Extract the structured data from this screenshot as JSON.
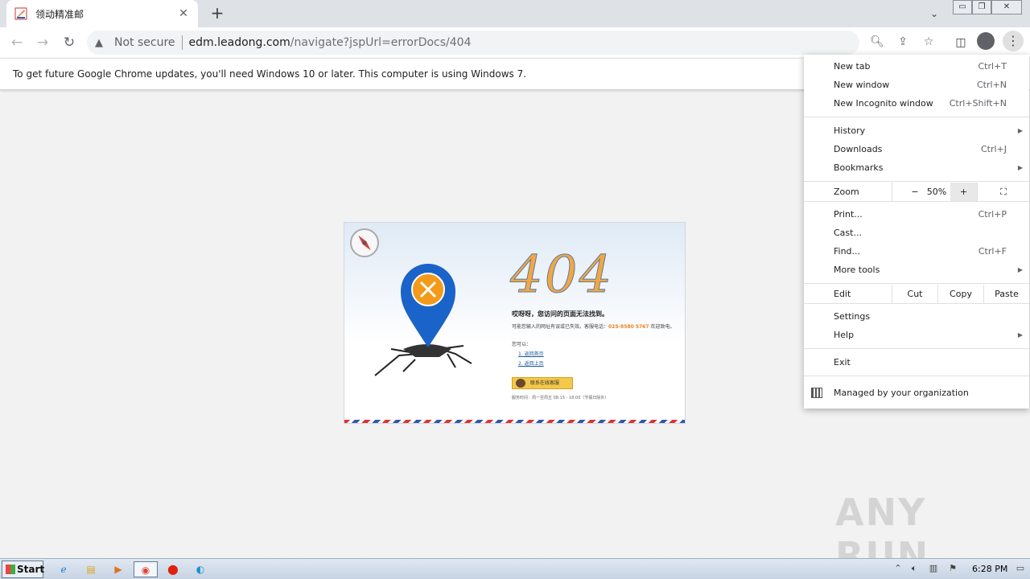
{
  "tab": {
    "title": "领动精准邮",
    "close": "✕",
    "new_tab": "+"
  },
  "toolbar": {
    "back": "←",
    "forward": "→",
    "reload": "↻",
    "security_label": "Not secure",
    "url_host": "edm.leadong.com",
    "url_path": "/navigate?jspUrl=errorDocs/404"
  },
  "infobar": {
    "message": "To get future Google Chrome updates, you'll need Windows 10 or later. This computer is using Windows 7."
  },
  "page": {
    "code": "404",
    "title": "哎呀呀，您访问的页面无法找到。",
    "desc": "可能您输入的网址有误或已失效。客服电话：",
    "phone": "025-8580 5767",
    "desc_suffix": " 欢迎致电。",
    "suggest": "您可以：",
    "links": [
      "1. 返回首页",
      "2. 返回上页"
    ],
    "service_button": "联系在线客服",
    "footer": "服务时间：周一至周五 08:15 - 18:00（节假日除外）"
  },
  "menu": {
    "items": [
      {
        "label": "New tab",
        "shortcut": "Ctrl+T"
      },
      {
        "label": "New window",
        "shortcut": "Ctrl+N"
      },
      {
        "label": "New Incognito window",
        "shortcut": "Ctrl+Shift+N"
      },
      {
        "label": "History",
        "shortcut": ""
      },
      {
        "label": "Downloads",
        "shortcut": "Ctrl+J"
      },
      {
        "label": "Bookmarks",
        "shortcut": ""
      },
      {
        "label": "Zoom",
        "shortcut": ""
      },
      {
        "label": "Print...",
        "shortcut": "Ctrl+P"
      },
      {
        "label": "Cast...",
        "shortcut": ""
      },
      {
        "label": "Find...",
        "shortcut": "Ctrl+F"
      },
      {
        "label": "More tools",
        "shortcut": ""
      },
      {
        "label": "Edit",
        "shortcut": ""
      },
      {
        "label": "Settings",
        "shortcut": ""
      },
      {
        "label": "Help",
        "shortcut": ""
      },
      {
        "label": "Exit",
        "shortcut": ""
      },
      {
        "label": "Managed by your organization",
        "shortcut": ""
      }
    ],
    "zoom": {
      "minus": "−",
      "value": "50%",
      "plus": "+",
      "fullscreen": "⛶"
    },
    "edit": {
      "cut": "Cut",
      "copy": "Copy",
      "paste": "Paste"
    }
  },
  "taskbar": {
    "start": "Start",
    "clock": "6:28 PM"
  },
  "watermark": "ANY RUN"
}
